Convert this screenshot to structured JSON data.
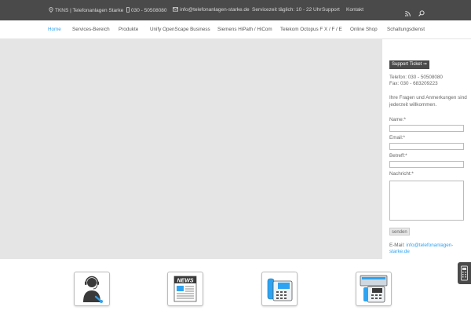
{
  "topbar": {
    "company": "TKNS | Telefonanlagen Starke",
    "phone": "030 - 50508080",
    "email": "info@telefonanlagen-starke.de",
    "service_hours": "Servicezeit täglich: 10 - 22 Uhr",
    "support": "Support",
    "contact": "Kontakt",
    "icons": [
      "location-icon",
      "phone-icon",
      "mail-icon",
      "rss-icon",
      "search-icon"
    ]
  },
  "nav": {
    "items": [
      "Home",
      "Services-Bereich",
      "Produkte",
      "Unify OpenScape Business",
      "Siemens HiPath / HiCom",
      "Telekom Octopus F X / F / E",
      "Online Shop",
      "Schaltungsdienst"
    ],
    "active": "Home"
  },
  "sidebar": {
    "ticket_button": "Support Ticket ➞",
    "phone": "Telefon: 030 - 50508080",
    "fax": "Fax: 030 - 683209223",
    "intro_line1": "Ihre Fragen und Anmerkungen sind",
    "intro_line2": "jederzeit willkommen.",
    "name_label": "Name:*",
    "email_label": "Email:*",
    "subject_label": "Betreff:*",
    "message_label": "Nachricht:*",
    "send_button": "senden",
    "email_prefix": "E-Mail: ",
    "email_link_line1": "info@telefonanlagen-",
    "email_link_line2": "starke.de"
  },
  "icon_row": {
    "items": [
      "support-agent-icon",
      "news-icon",
      "telephone-system-icon",
      "phone-shop-icon"
    ],
    "news_text": "NEWS"
  },
  "colors": {
    "topbar_bg": "#4a4a4a",
    "accent": "#2ea3f2",
    "hero_bg": "#e5e5e5"
  }
}
